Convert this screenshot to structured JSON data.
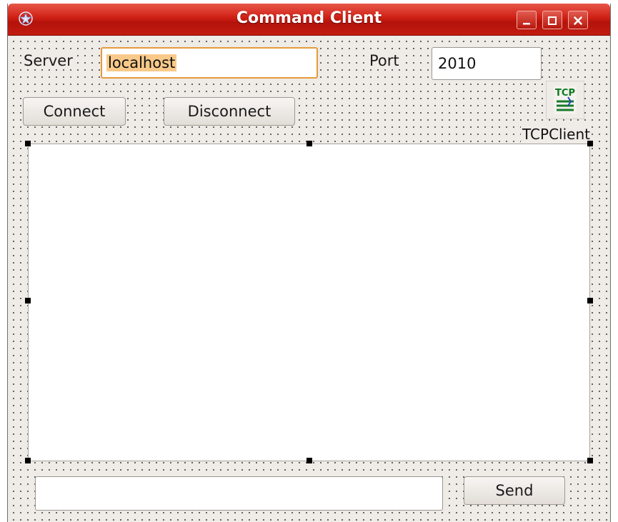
{
  "window": {
    "title": "Command Client",
    "titlebar_color": "#c21b10",
    "buttons": [
      "minimize-icon",
      "maximize-icon",
      "close-icon"
    ]
  },
  "form": {
    "background": "#efebe7",
    "server": {
      "label": "Server",
      "value": "localhost"
    },
    "port": {
      "label": "Port",
      "value": "2010"
    },
    "connect_label": "Connect",
    "disconnect_label": "Disconnect",
    "tcp_component": {
      "icon": "tcp-client-icon",
      "label": "TCPClient"
    },
    "memo": {
      "value": ""
    },
    "send_input": {
      "value": ""
    },
    "send_label": "Send"
  }
}
